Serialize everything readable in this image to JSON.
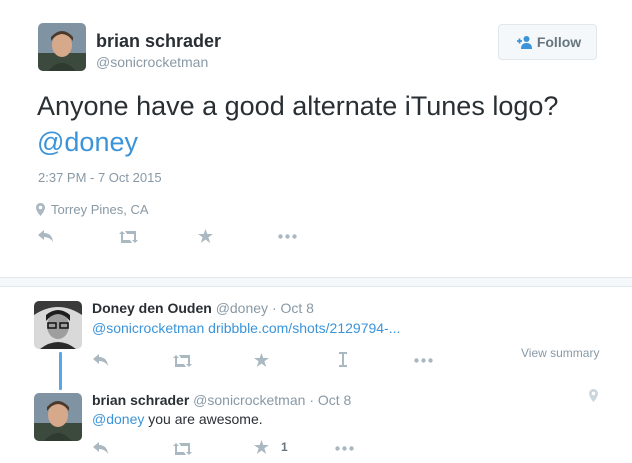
{
  "tweet": {
    "author_name": "brian schrader",
    "author_handle": "@sonicrocketman",
    "follow_label": "Follow",
    "text_line1": "Anyone have a good alternate iTunes logo?",
    "text_mention": "@doney",
    "timestamp": "2:37 PM - 7 Oct 2015",
    "location": "Torrey Pines, CA"
  },
  "replies": [
    {
      "author_name": "Doney den Ouden",
      "author_handle": "@doney",
      "separator": "·",
      "date": "Oct 8",
      "text_mention": "@sonicrocketman",
      "text_link": "dribbble.com/shots/2129794-...",
      "view_summary": "View summary"
    },
    {
      "author_name": "brian schrader",
      "author_handle": "@sonicrocketman",
      "separator": "·",
      "date": "Oct 8",
      "text_mention": "@doney",
      "text_rest": " you are awesome.",
      "favorite_count": "1"
    }
  ],
  "icons": {
    "reply": "reply-icon",
    "retweet": "retweet-icon",
    "favorite": "star-icon",
    "more": "more-dots-icon",
    "vine_like": "i-beam-icon",
    "location": "location-pin-icon",
    "follow": "add-user-icon"
  },
  "colors": {
    "link": "#3b94d9",
    "muted": "#8899a6",
    "action_icon": "#aab8c2",
    "thread_line": "#59a6e6"
  }
}
